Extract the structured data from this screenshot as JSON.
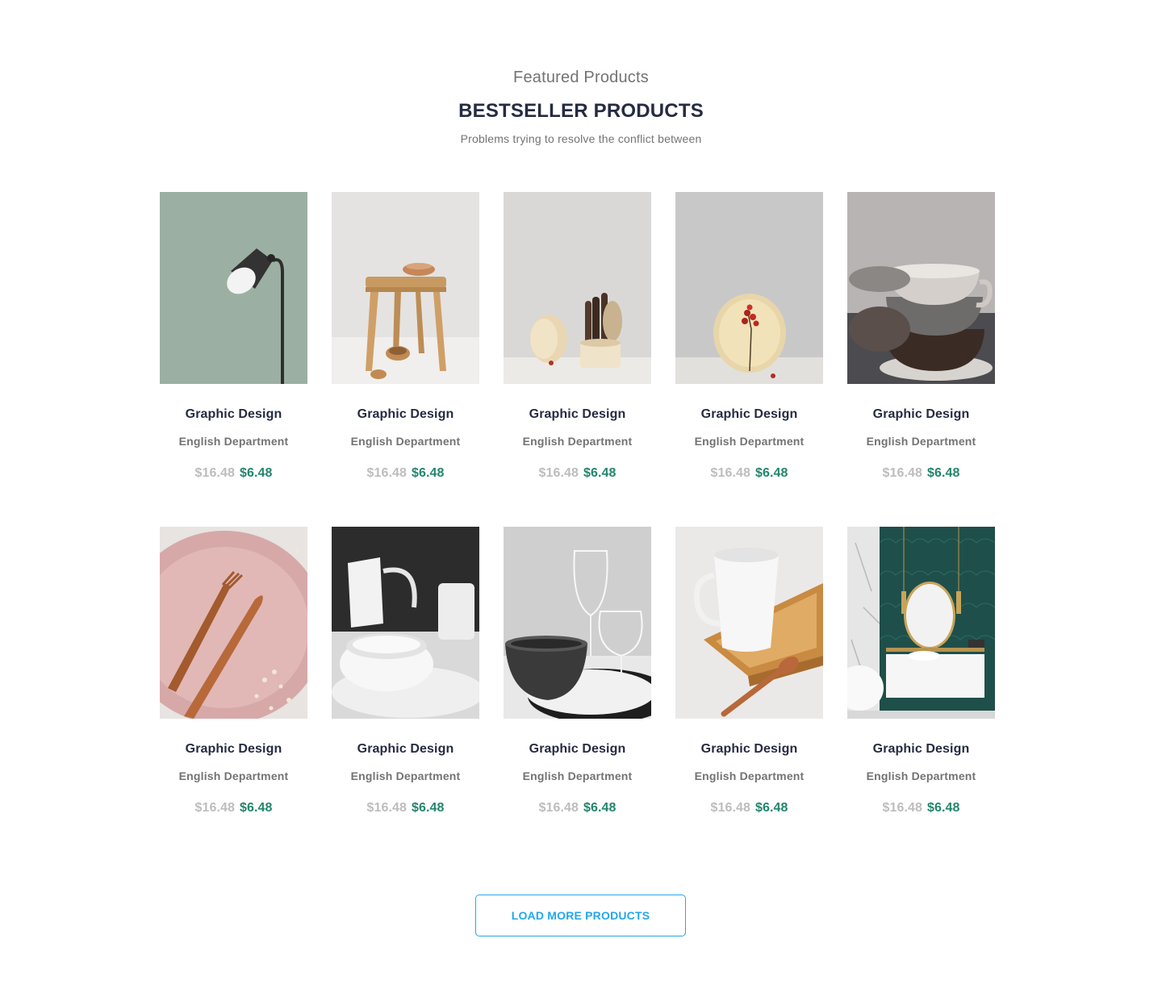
{
  "section": {
    "eyebrow": "Featured Products",
    "title": "BESTSELLER PRODUCTS",
    "subtitle": "Problems trying to resolve the conflict between"
  },
  "products": [
    {
      "title": "Graphic Design",
      "department": "English Department",
      "old_price": "$16.48",
      "new_price": "$6.48",
      "image": "floor-lamp"
    },
    {
      "title": "Graphic Design",
      "department": "English Department",
      "old_price": "$16.48",
      "new_price": "$6.48",
      "image": "wooden-stool"
    },
    {
      "title": "Graphic Design",
      "department": "English Department",
      "old_price": "$16.48",
      "new_price": "$6.48",
      "image": "wooden-cutlery"
    },
    {
      "title": "Graphic Design",
      "department": "English Department",
      "old_price": "$16.48",
      "new_price": "$6.48",
      "image": "plate-berries"
    },
    {
      "title": "Graphic Design",
      "department": "English Department",
      "old_price": "$16.48",
      "new_price": "$6.48",
      "image": "stacked-cups"
    },
    {
      "title": "Graphic Design",
      "department": "English Department",
      "old_price": "$16.48",
      "new_price": "$6.48",
      "image": "copper-cutlery"
    },
    {
      "title": "Graphic Design",
      "department": "English Department",
      "old_price": "$16.48",
      "new_price": "$6.48",
      "image": "white-dishes"
    },
    {
      "title": "Graphic Design",
      "department": "English Department",
      "old_price": "$16.48",
      "new_price": "$6.48",
      "image": "wine-glasses"
    },
    {
      "title": "Graphic Design",
      "department": "English Department",
      "old_price": "$16.48",
      "new_price": "$6.48",
      "image": "mug-tray"
    },
    {
      "title": "Graphic Design",
      "department": "English Department",
      "old_price": "$16.48",
      "new_price": "$6.48",
      "image": "bathroom"
    }
  ],
  "load_more": {
    "label": "LOAD MORE PRODUCTS"
  },
  "colors": {
    "heading": "#252b42",
    "muted": "#737373",
    "old_price": "#bdbdbd",
    "new_price": "#23856d",
    "accent": "#23a6f0"
  }
}
